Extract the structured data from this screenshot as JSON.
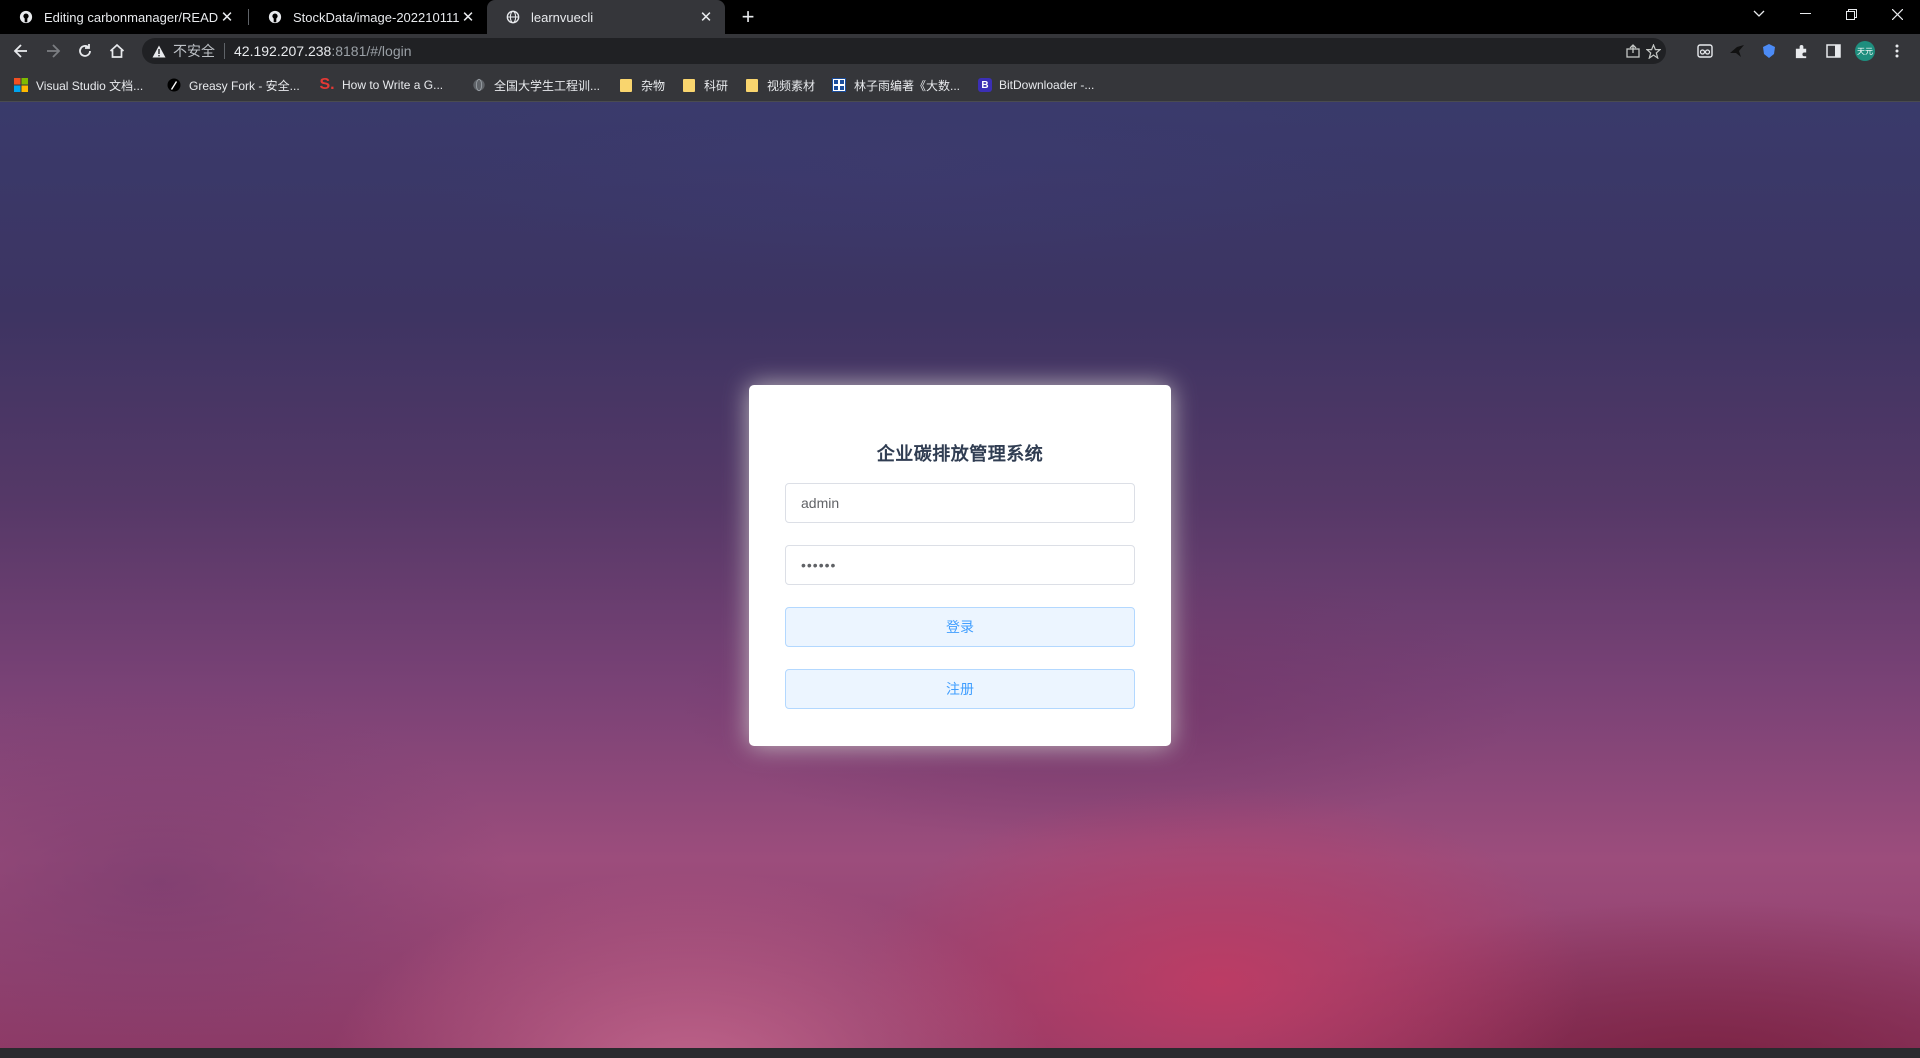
{
  "browser": {
    "tabs": [
      {
        "title": "Editing carbonmanager/READ",
        "icon": "github-icon",
        "active": false
      },
      {
        "title": "StockData/image-2022101111",
        "icon": "github-icon",
        "active": false
      },
      {
        "title": "learnvuecli",
        "icon": "globe-icon",
        "active": true
      }
    ],
    "address": {
      "security_label": "不安全",
      "host": "42.192.207.238",
      "path": ":8181/#/login"
    },
    "profile_badge": "天元",
    "bookmarks": [
      {
        "label": "Visual Studio 文档...",
        "icon": "windows-icon"
      },
      {
        "label": "Greasy Fork - 安全...",
        "icon": "greasyfork-icon"
      },
      {
        "label": "How to Write a G...",
        "icon": "s-logo-icon"
      },
      {
        "label": "全国大学生工程训...",
        "icon": "globe-icon"
      },
      {
        "label": "杂物",
        "icon": "folder-icon"
      },
      {
        "label": "科研",
        "icon": "folder-icon"
      },
      {
        "label": "视频素材",
        "icon": "folder-icon"
      },
      {
        "label": "林子雨编著《大数...",
        "icon": "grid-icon"
      },
      {
        "label": "BitDownloader -...",
        "icon": "b-logo-icon"
      }
    ]
  },
  "login": {
    "title": "企业碳排放管理系统",
    "username_value": "admin",
    "password_value": "••••••",
    "login_label": "登录",
    "register_label": "注册"
  },
  "colors": {
    "accent": "#409eff",
    "button_bg": "#ecf5ff",
    "title": "#303d52"
  }
}
